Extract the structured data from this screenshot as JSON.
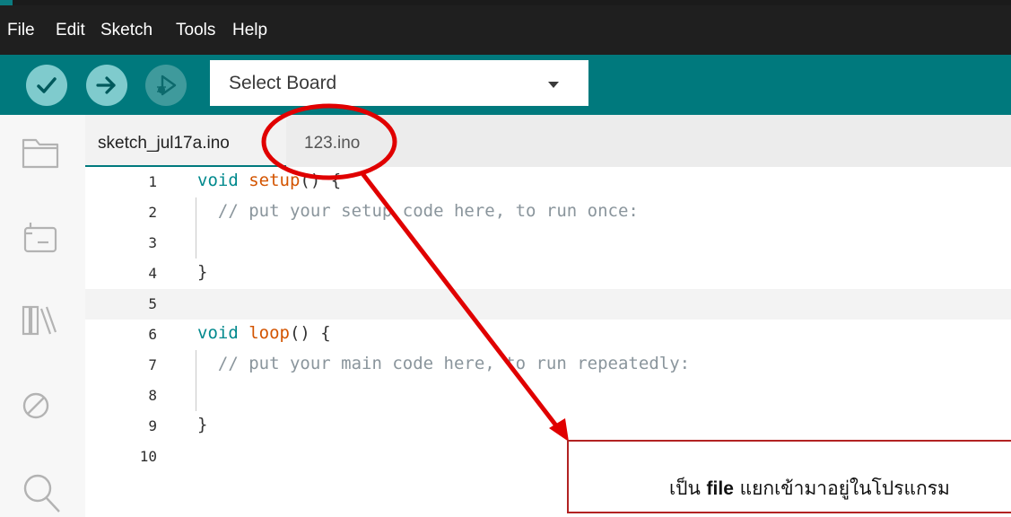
{
  "menu": {
    "items": [
      "File",
      "Edit",
      "Sketch",
      "Tools",
      "Help"
    ]
  },
  "toolbar": {
    "verify_icon": "checkmark-icon",
    "upload_icon": "arrow-right-icon",
    "debug_icon": "debug-play-icon",
    "board_select_label": "Select Board",
    "accent_color": "#00797d"
  },
  "sidebar": {
    "icons": [
      "folder-icon",
      "board-icon",
      "library-icon",
      "ban-icon",
      "search-icon"
    ]
  },
  "tabs": [
    {
      "label": "sketch_jul17a.ino",
      "active": true
    },
    {
      "label": "123.ino",
      "active": false
    }
  ],
  "editor": {
    "lines": [
      {
        "n": "1",
        "tokens": [
          {
            "t": "kw",
            "v": "void "
          },
          {
            "t": "fn",
            "v": "setup"
          },
          {
            "t": "pl",
            "v": "() {"
          }
        ]
      },
      {
        "n": "2",
        "tokens": [
          {
            "t": "cm",
            "v": "  // put your setup code here, to run once:"
          }
        ]
      },
      {
        "n": "3",
        "tokens": []
      },
      {
        "n": "4",
        "tokens": [
          {
            "t": "pl",
            "v": "}"
          }
        ]
      },
      {
        "n": "5",
        "tokens": []
      },
      {
        "n": "6",
        "tokens": [
          {
            "t": "kw",
            "v": "void "
          },
          {
            "t": "fn",
            "v": "loop"
          },
          {
            "t": "pl",
            "v": "() {"
          }
        ]
      },
      {
        "n": "7",
        "tokens": [
          {
            "t": "cm",
            "v": "  // put your main code here, to run repeatedly:"
          }
        ]
      },
      {
        "n": "8",
        "tokens": []
      },
      {
        "n": "9",
        "tokens": [
          {
            "t": "pl",
            "v": "}"
          }
        ]
      },
      {
        "n": "10",
        "tokens": []
      }
    ],
    "highlighted_line": "5"
  },
  "annotation": {
    "prefix": "เป็น ",
    "bold": "file",
    "suffix": " แยกเข้ามาอยู่ในโปรแกรม",
    "color": "#e00000"
  }
}
